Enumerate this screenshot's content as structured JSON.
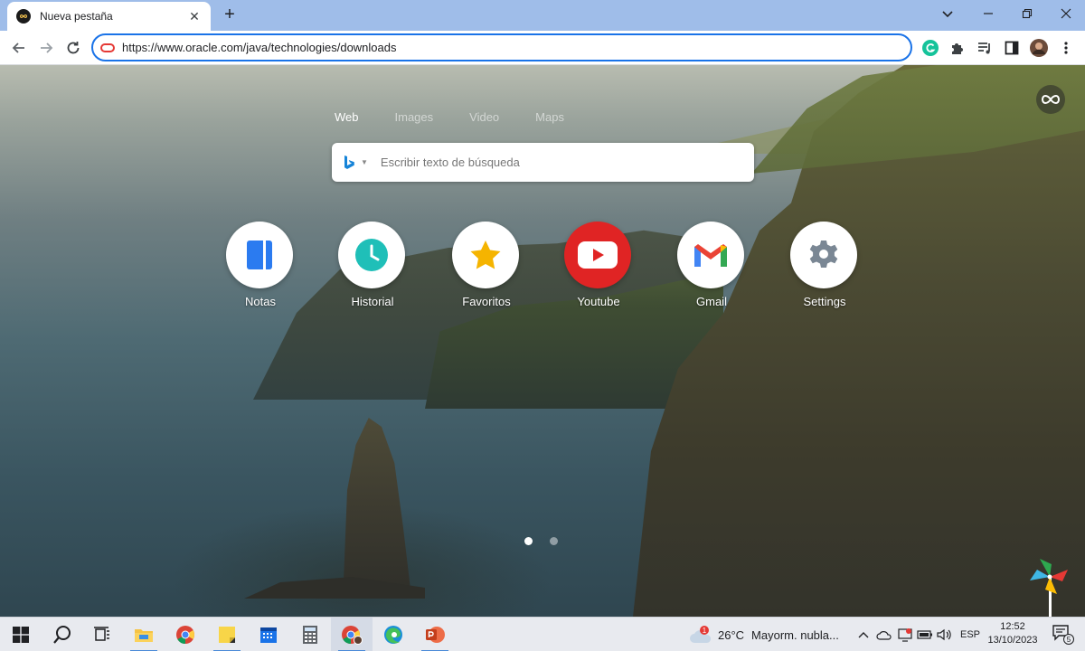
{
  "browser": {
    "tab": {
      "title": "Nueva pestaña",
      "close_label": "✕"
    },
    "new_tab_label": "+",
    "address": {
      "url": "https://www.oracle.com/java/technologies/downloads"
    }
  },
  "newtab": {
    "search_tabs": [
      {
        "label": "Web",
        "active": true
      },
      {
        "label": "Images",
        "active": false
      },
      {
        "label": "Video",
        "active": false
      },
      {
        "label": "Maps",
        "active": false
      }
    ],
    "search": {
      "placeholder": "Escribir texto de búsqueda"
    },
    "shortcuts": [
      {
        "label": "Notas",
        "icon": "notes-icon",
        "color": "#2b7bf0"
      },
      {
        "label": "Historial",
        "icon": "clock-icon",
        "color": "#1fbfb8"
      },
      {
        "label": "Favoritos",
        "icon": "star-icon",
        "color": "#f5b400"
      },
      {
        "label": "Youtube",
        "icon": "youtube-icon",
        "color": "#ff0000"
      },
      {
        "label": "Gmail",
        "icon": "gmail-icon",
        "color": "#ea4335"
      },
      {
        "label": "Settings",
        "icon": "gear-icon",
        "color": "#7a8794"
      }
    ],
    "pager": {
      "pages": 2,
      "current": 1
    }
  },
  "taskbar": {
    "weather": {
      "temp": "26°C",
      "condition": "Mayorm. nubla...",
      "badge": "1"
    },
    "language": "ESP",
    "clock": {
      "time": "12:52",
      "date": "13/10/2023"
    },
    "notifications": "5"
  },
  "colors": {
    "accent": "#1a73e8",
    "tabstrip": "#9fbde9",
    "taskbar": "#e8eaef"
  }
}
